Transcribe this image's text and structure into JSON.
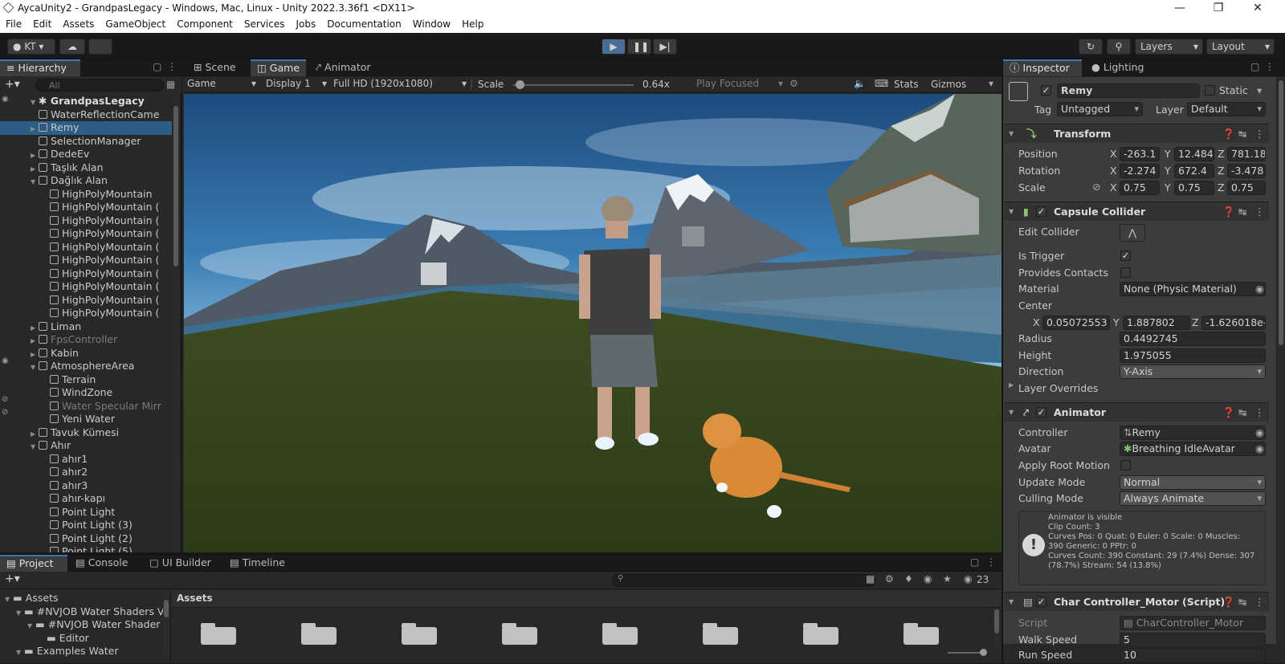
{
  "window": {
    "title": "AycaUnity2 - GrandpasLegacy - Windows, Mac, Linux - Unity 2022.3.36f1 <DX11>",
    "minimize": "—",
    "maximize": "❐",
    "close": "✕"
  },
  "menu": [
    "File",
    "Edit",
    "Assets",
    "GameObject",
    "Component",
    "Services",
    "Jobs",
    "Documentation",
    "Window",
    "Help"
  ],
  "toolbar": {
    "account": "KT",
    "layers": "Layers",
    "layout": "Layout"
  },
  "hierarchy": {
    "tab": "Hierarchy",
    "search_placeholder": "All",
    "scene": "GrandpasLegacy",
    "items": [
      {
        "label": "WaterReflectionCame",
        "indent": 1,
        "arrow": "",
        "greyed": false
      },
      {
        "label": "Remy",
        "indent": 1,
        "arrow": "▶",
        "greyed": false,
        "selected": true
      },
      {
        "label": "SelectionManager",
        "indent": 1,
        "arrow": "",
        "greyed": false
      },
      {
        "label": "DedeEv",
        "indent": 1,
        "arrow": "▶",
        "greyed": false
      },
      {
        "label": "Taşlık Alan",
        "indent": 1,
        "arrow": "▶",
        "greyed": false
      },
      {
        "label": "Dağlık Alan",
        "indent": 1,
        "arrow": "▼",
        "greyed": false
      },
      {
        "label": "HighPolyMountain",
        "indent": 2,
        "arrow": "",
        "greyed": false
      },
      {
        "label": "HighPolyMountain (",
        "indent": 2,
        "arrow": "",
        "greyed": false
      },
      {
        "label": "HighPolyMountain (",
        "indent": 2,
        "arrow": "",
        "greyed": false
      },
      {
        "label": "HighPolyMountain (",
        "indent": 2,
        "arrow": "",
        "greyed": false
      },
      {
        "label": "HighPolyMountain (",
        "indent": 2,
        "arrow": "",
        "greyed": false
      },
      {
        "label": "HighPolyMountain (",
        "indent": 2,
        "arrow": "",
        "greyed": false
      },
      {
        "label": "HighPolyMountain (",
        "indent": 2,
        "arrow": "",
        "greyed": false
      },
      {
        "label": "HighPolyMountain (",
        "indent": 2,
        "arrow": "",
        "greyed": false
      },
      {
        "label": "HighPolyMountain (",
        "indent": 2,
        "arrow": "",
        "greyed": false
      },
      {
        "label": "HighPolyMountain (",
        "indent": 2,
        "arrow": "",
        "greyed": false
      },
      {
        "label": "Liman",
        "indent": 1,
        "arrow": "▶",
        "greyed": false
      },
      {
        "label": "FpsController",
        "indent": 1,
        "arrow": "▶",
        "greyed": true
      },
      {
        "label": "Kabin",
        "indent": 1,
        "arrow": "▶",
        "greyed": false
      },
      {
        "label": "AtmosphereArea",
        "indent": 1,
        "arrow": "▼",
        "greyed": false
      },
      {
        "label": "Terrain",
        "indent": 2,
        "arrow": "",
        "greyed": false
      },
      {
        "label": "WindZone",
        "indent": 2,
        "arrow": "",
        "greyed": false
      },
      {
        "label": "Water Specular Mirr",
        "indent": 2,
        "arrow": "",
        "greyed": true
      },
      {
        "label": "Yeni Water",
        "indent": 2,
        "arrow": "",
        "greyed": false
      },
      {
        "label": "Tavuk Kümesi",
        "indent": 1,
        "arrow": "▶",
        "greyed": false
      },
      {
        "label": "Ahır",
        "indent": 1,
        "arrow": "▼",
        "greyed": false
      },
      {
        "label": "ahır1",
        "indent": 2,
        "arrow": "",
        "greyed": false
      },
      {
        "label": "ahır2",
        "indent": 2,
        "arrow": "",
        "greyed": false
      },
      {
        "label": "ahır3",
        "indent": 2,
        "arrow": "",
        "greyed": false
      },
      {
        "label": "ahır-kapı",
        "indent": 2,
        "arrow": "",
        "greyed": false
      },
      {
        "label": "Point Light",
        "indent": 2,
        "arrow": "",
        "greyed": false
      },
      {
        "label": "Point Light (3)",
        "indent": 2,
        "arrow": "",
        "greyed": false
      },
      {
        "label": "Point Light (2)",
        "indent": 2,
        "arrow": "",
        "greyed": false
      },
      {
        "label": "Point Light (5)",
        "indent": 2,
        "arrow": "",
        "greyed": false
      }
    ]
  },
  "center_tabs": {
    "scene": "Scene",
    "game": "Game",
    "animator": "Animator"
  },
  "game_bar": {
    "display_mode": "Game",
    "display": "Display 1",
    "resolution": "Full HD (1920x1080)",
    "scale_label": "Scale",
    "scale_value": "0.64x",
    "scale_fraction": 0.05,
    "play_focused": "Play Focused",
    "stats": "Stats",
    "gizmos": "Gizmos"
  },
  "inspector": {
    "tab": "Inspector",
    "lighting_tab": "Lighting",
    "object_name": "Remy",
    "static_label": "Static",
    "tag_label": "Tag",
    "tag_value": "Untagged",
    "layer_label": "Layer",
    "layer_value": "Default",
    "transform": {
      "title": "Transform",
      "position_label": "Position",
      "rotation_label": "Rotation",
      "scale_label": "Scale",
      "position": {
        "x": "-263.1",
        "y": "12.484",
        "z": "781.18"
      },
      "rotation": {
        "x": "-2.274",
        "y": "672.4",
        "z": "-3.478"
      },
      "scale": {
        "x": "0.75",
        "y": "0.75",
        "z": "0.75"
      }
    },
    "capsule": {
      "title": "Capsule Collider",
      "edit_collider": "Edit Collider",
      "is_trigger": "Is Trigger",
      "provides_contacts": "Provides Contacts",
      "material_label": "Material",
      "material_value": "None (Physic Material)",
      "center_label": "Center",
      "center": {
        "x": "0.05072553",
        "y": "1.887802",
        "z": "-1.626018e-"
      },
      "radius_label": "Radius",
      "radius": "0.4492745",
      "height_label": "Height",
      "height": "1.975055",
      "direction_label": "Direction",
      "direction": "Y-Axis",
      "layer_overrides": "Layer Overrides"
    },
    "animator": {
      "title": "Animator",
      "controller_label": "Controller",
      "controller": "Remy",
      "avatar_label": "Avatar",
      "avatar": "Breathing IdleAvatar",
      "root_motion_label": "Apply Root Motion",
      "update_mode_label": "Update Mode",
      "update_mode": "Normal",
      "culling_mode_label": "Culling Mode",
      "culling_mode": "Always Animate",
      "info": [
        "Animator is visible",
        "Clip Count: 3",
        "Curves Pos: 0 Quat: 0 Euler: 0 Scale: 0 Muscles:",
        "390 Generic: 0 PPtr: 0",
        "Curves Count: 390 Constant: 29 (7.4%) Dense: 307",
        "(78.7%) Stream: 54 (13.8%)"
      ]
    },
    "char_controller": {
      "title": "Char Controller_Motor (Script)",
      "script_label": "Script",
      "script": "CharController_Motor",
      "walk_label": "Walk Speed",
      "walk": "5",
      "run_label": "Run Speed",
      "run": "10"
    },
    "axes": {
      "x": "X",
      "y": "Y",
      "z": "Z"
    }
  },
  "bottom": {
    "tabs": {
      "project": "Project",
      "console": "Console",
      "ui_builder": "UI Builder",
      "timeline": "Timeline"
    },
    "tree": [
      {
        "label": "Assets",
        "indent": 0,
        "arrow": "▼"
      },
      {
        "label": "#NVJOB Water Shaders V",
        "indent": 1,
        "arrow": "▼"
      },
      {
        "label": "#NVJOB Water Shader",
        "indent": 2,
        "arrow": "▼"
      },
      {
        "label": "Editor",
        "indent": 3,
        "arrow": ""
      },
      {
        "label": "Examples Water",
        "indent": 1,
        "arrow": "▼"
      }
    ],
    "breadcrumb": "Assets",
    "hidden_count": "23"
  }
}
